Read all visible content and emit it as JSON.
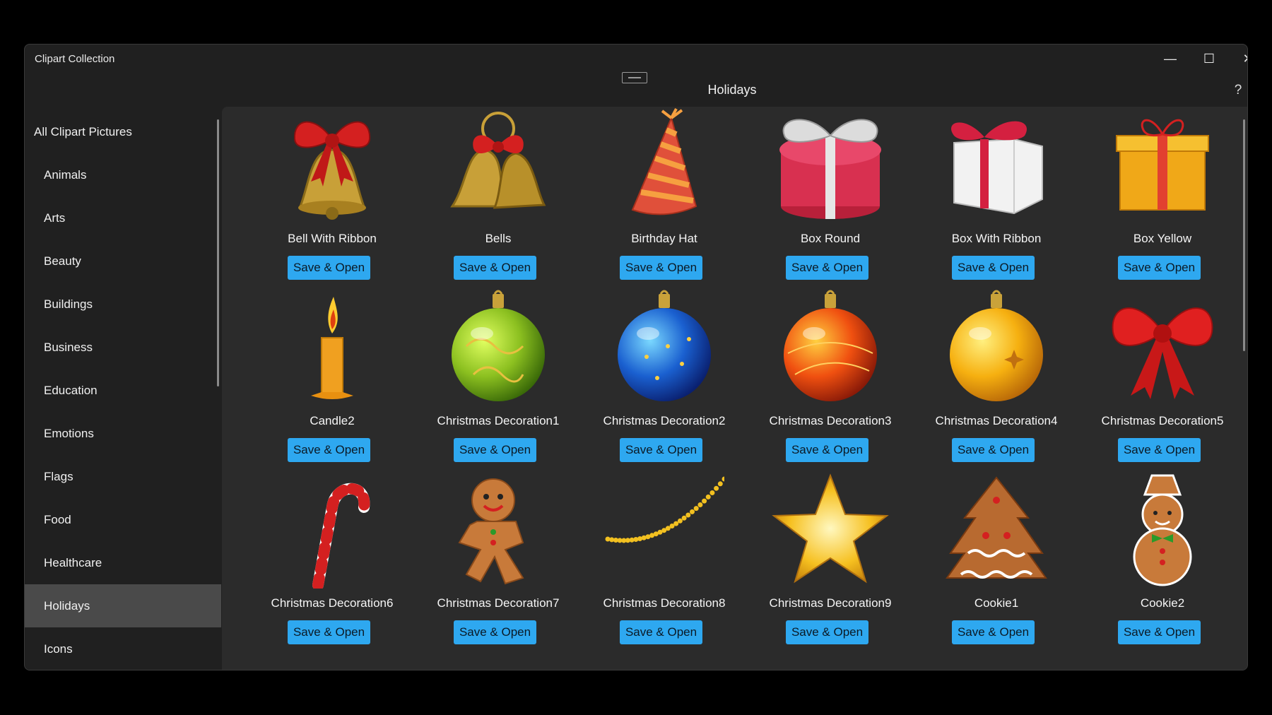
{
  "app": {
    "title": "Clipart Collection",
    "page_title": "Holidays",
    "help": "?"
  },
  "window_controls": {
    "minimize": "—",
    "maximize": "☐",
    "close": "✕"
  },
  "sidebar": {
    "items": [
      {
        "label": "All Clipart Pictures",
        "top_level": true
      },
      {
        "label": "Animals"
      },
      {
        "label": "Arts"
      },
      {
        "label": "Beauty"
      },
      {
        "label": "Buildings"
      },
      {
        "label": "Business"
      },
      {
        "label": "Education"
      },
      {
        "label": "Emotions"
      },
      {
        "label": "Flags"
      },
      {
        "label": "Food"
      },
      {
        "label": "Healthcare"
      },
      {
        "label": "Holidays",
        "selected": true
      },
      {
        "label": "Icons"
      }
    ]
  },
  "gallery": {
    "button_label": "Save & Open",
    "items": [
      {
        "name": "Bell With Ribbon",
        "icon": "bell-with-ribbon-icon"
      },
      {
        "name": "Bells",
        "icon": "bells-icon"
      },
      {
        "name": "Birthday Hat",
        "icon": "birthday-hat-icon"
      },
      {
        "name": "Box Round",
        "icon": "box-round-icon"
      },
      {
        "name": "Box With Ribbon",
        "icon": "box-with-ribbon-icon"
      },
      {
        "name": "Box Yellow",
        "icon": "box-yellow-icon"
      },
      {
        "name": "Candle2",
        "icon": "candle-icon"
      },
      {
        "name": "Christmas Decoration1",
        "icon": "green-ornament-icon"
      },
      {
        "name": "Christmas Decoration2",
        "icon": "blue-ornament-icon"
      },
      {
        "name": "Christmas Decoration3",
        "icon": "red-ornament-icon"
      },
      {
        "name": "Christmas Decoration4",
        "icon": "yellow-ornament-icon"
      },
      {
        "name": "Christmas Decoration5",
        "icon": "red-bow-icon"
      },
      {
        "name": "Christmas Decoration6",
        "icon": "candy-cane-icon"
      },
      {
        "name": "Christmas Decoration7",
        "icon": "gingerbread-man-icon"
      },
      {
        "name": "Christmas Decoration8",
        "icon": "bead-garland-icon"
      },
      {
        "name": "Christmas Decoration9",
        "icon": "star-icon"
      },
      {
        "name": "Cookie1",
        "icon": "tree-cookie-icon"
      },
      {
        "name": "Cookie2",
        "icon": "snowman-cookie-icon"
      }
    ]
  },
  "colors": {
    "accent_button": "#2ea8f0",
    "selected_nav": "#4a4a4a",
    "content_bg": "#2b2b2b",
    "window_bg": "#202020"
  }
}
